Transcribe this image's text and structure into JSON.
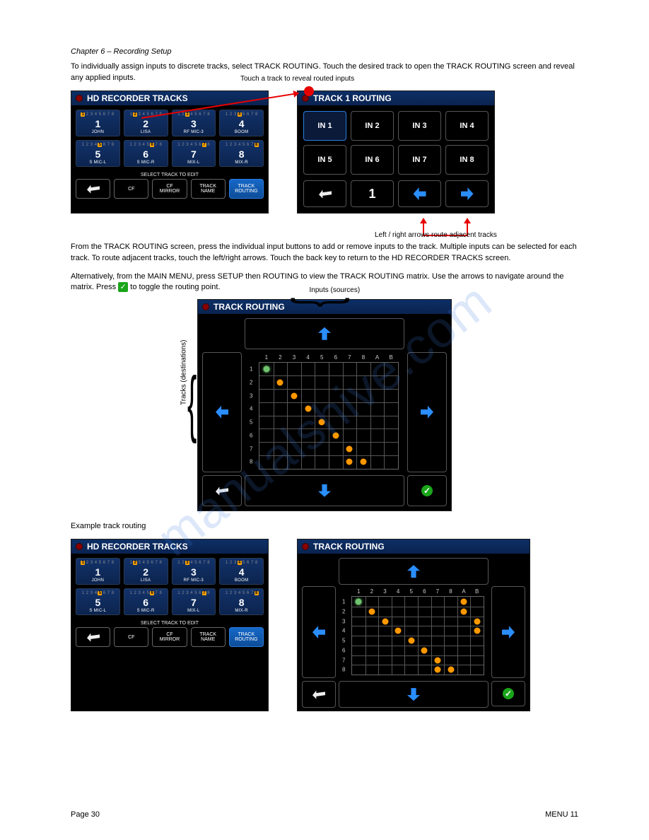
{
  "page": {
    "header": "Chapter 6 – Recording Setup",
    "para1": "To individually assign inputs to discrete tracks, select TRACK ROUTING. Touch the desired track to open the TRACK ROUTING screen and reveal any applied inputs.",
    "para2": "From the TRACK ROUTING screen, press the individual input buttons to add or remove inputs to the track. Multiple inputs can be selected for each track. To route adjacent tracks, touch the left/right arrows. Touch the back key to return to the HD RECORDER TRACKS screen.",
    "para3a": "Alternatively, from the MAIN MENU, press SETUP then ROUTING to view the TRACK ROUTING matrix. Use the arrows to navigate around the matrix. Press ",
    "para3b": " to toggle the routing point.",
    "para4": "Example track routing",
    "footer_left": "Page 30",
    "footer_right": "MENU 11"
  },
  "annotations": {
    "arrow_top": "Touch a track to reveal routed inputs",
    "arrows_bottom": "Left / right arrows route adjacent tracks",
    "brace_top": "Inputs (sources)",
    "brace_left": "Tracks (destinations)"
  },
  "panels": {
    "hd1": {
      "title": "HD RECORDER TRACKS",
      "tracks": [
        {
          "num": "1",
          "name": "JOHN",
          "mini": [
            1
          ]
        },
        {
          "num": "2",
          "name": "LISA",
          "mini": [
            2
          ]
        },
        {
          "num": "3",
          "name": "RF MIC-3",
          "mini": [
            3
          ]
        },
        {
          "num": "4",
          "name": "BOOM",
          "mini": [
            4
          ]
        },
        {
          "num": "5",
          "name": "S MIC-L",
          "mini": [
            5
          ]
        },
        {
          "num": "6",
          "name": "S MIC-R",
          "mini": [
            6
          ]
        },
        {
          "num": "7",
          "name": "MIX-L",
          "mini": [
            7
          ]
        },
        {
          "num": "8",
          "name": "MIX-R",
          "mini": [
            8
          ]
        }
      ],
      "select_label": "SELECT TRACK TO EDIT",
      "buttons": {
        "cf": "CF",
        "cf_mirror": "CF\nMIRROR",
        "track_name": "TRACK\nNAME",
        "track_routing": "TRACK\nROUTING"
      }
    },
    "route1": {
      "title": "TRACK 1 ROUTING",
      "inputs": [
        "IN 1",
        "IN 2",
        "IN 3",
        "IN 4",
        "IN 5",
        "IN 6",
        "IN 7",
        "IN 8"
      ],
      "selected": 0,
      "track_number": "1"
    },
    "matrix_large": {
      "title": "TRACK ROUTING",
      "cols": [
        "1",
        "2",
        "3",
        "4",
        "5",
        "6",
        "7",
        "8",
        "A",
        "B"
      ],
      "rows": [
        "1",
        "2",
        "3",
        "4",
        "5",
        "6",
        "7",
        "8"
      ],
      "points": [
        {
          "r": 1,
          "c": 1,
          "cursor": true
        },
        {
          "r": 2,
          "c": 2
        },
        {
          "r": 3,
          "c": 3
        },
        {
          "r": 4,
          "c": 4
        },
        {
          "r": 5,
          "c": 5
        },
        {
          "r": 6,
          "c": 6
        },
        {
          "r": 7,
          "c": 7
        },
        {
          "r": 8,
          "c": 7
        },
        {
          "r": 8,
          "c": 8
        }
      ]
    },
    "hd2": {
      "title": "HD RECORDER TRACKS",
      "tracks": [
        {
          "num": "1",
          "name": "JOHN",
          "mini": [
            1
          ]
        },
        {
          "num": "2",
          "name": "LISA",
          "mini": [
            2
          ]
        },
        {
          "num": "3",
          "name": "RF MIC-3",
          "mini": [
            3
          ]
        },
        {
          "num": "4",
          "name": "BOOM",
          "mini": [
            4
          ]
        },
        {
          "num": "5",
          "name": "S MIC-L",
          "mini": [
            5
          ]
        },
        {
          "num": "6",
          "name": "S MIC-R",
          "mini": [
            6
          ]
        },
        {
          "num": "7",
          "name": "MIX-L",
          "mini": [
            7
          ]
        },
        {
          "num": "8",
          "name": "MIX-R",
          "mini": [
            8
          ]
        }
      ],
      "select_label": "SELECT TRACK TO EDIT",
      "buttons": {
        "cf": "CF",
        "cf_mirror": "CF\nMIRROR",
        "track_name": "TRACK\nNAME",
        "track_routing": "TRACK\nROUTING"
      }
    },
    "matrix_small": {
      "title": "TRACK ROUTING",
      "cols": [
        "1",
        "2",
        "3",
        "4",
        "5",
        "6",
        "7",
        "8",
        "A",
        "B"
      ],
      "rows": [
        "1",
        "2",
        "3",
        "4",
        "5",
        "6",
        "7",
        "8"
      ],
      "points": [
        {
          "r": 1,
          "c": 1,
          "cursor": true
        },
        {
          "r": 1,
          "c": 9
        },
        {
          "r": 2,
          "c": 2
        },
        {
          "r": 2,
          "c": 9
        },
        {
          "r": 3,
          "c": 3
        },
        {
          "r": 3,
          "c": 10
        },
        {
          "r": 4,
          "c": 4
        },
        {
          "r": 4,
          "c": 10
        },
        {
          "r": 5,
          "c": 5
        },
        {
          "r": 6,
          "c": 6
        },
        {
          "r": 7,
          "c": 7
        },
        {
          "r": 8,
          "c": 7
        },
        {
          "r": 8,
          "c": 8
        }
      ]
    }
  },
  "watermark": "manualshive.com"
}
